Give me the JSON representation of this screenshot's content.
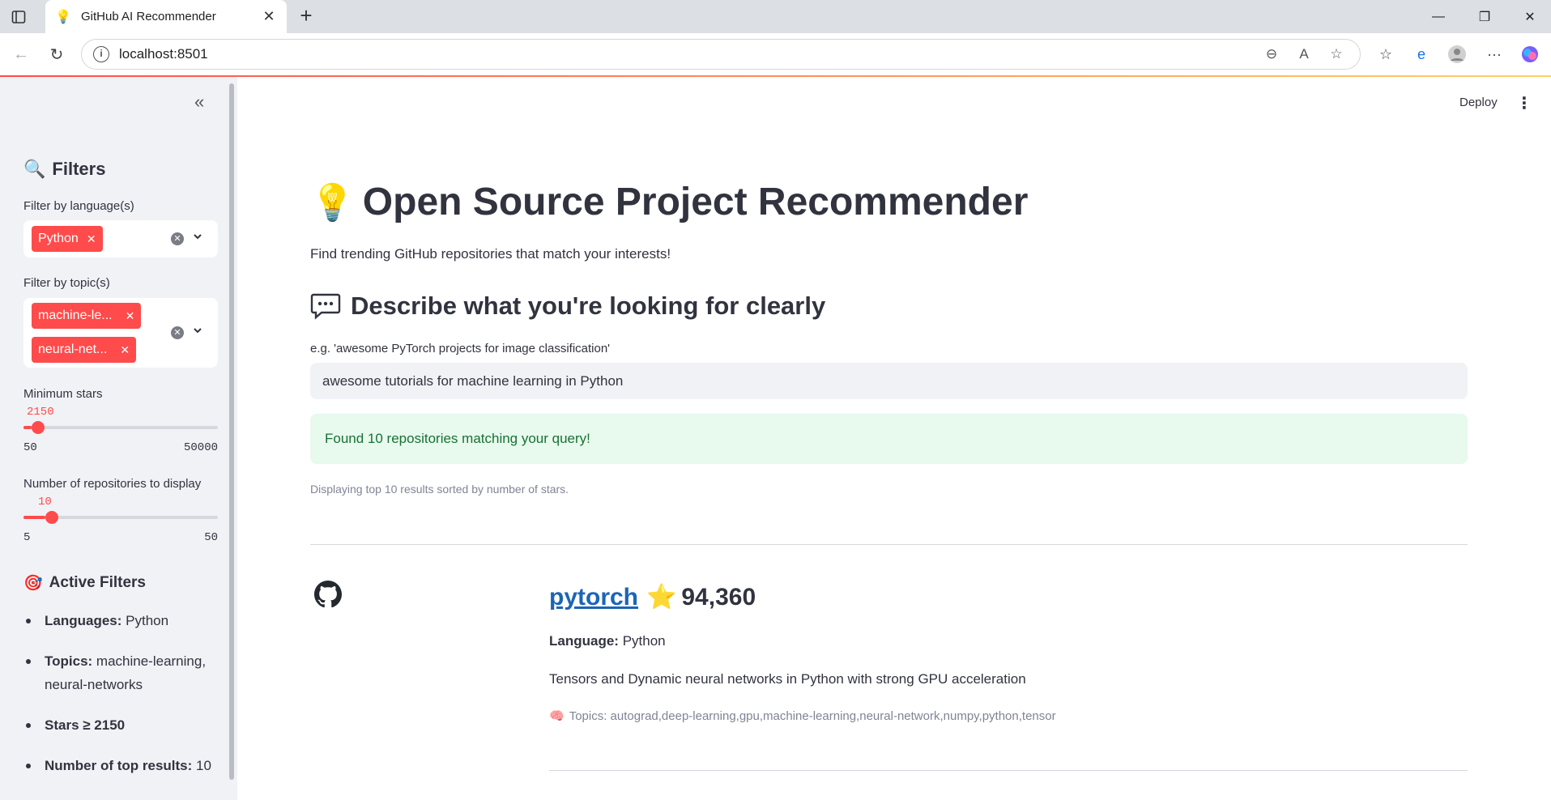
{
  "browser": {
    "tab_title": "GitHub AI Recommender",
    "url": "localhost:8501"
  },
  "sidebar": {
    "filters_heading": "Filters",
    "language_label": "Filter by language(s)",
    "language_chips": [
      "Python"
    ],
    "topic_label": "Filter by topic(s)",
    "topic_chips": [
      "machine-le...",
      "neural-net..."
    ],
    "min_stars_label": "Minimum stars",
    "min_stars_value": "2150",
    "min_stars_fraction": 0.042,
    "min_stars_min": "50",
    "min_stars_max": "50000",
    "num_repos_label": "Number of repositories to display",
    "num_repos_value": "10",
    "num_repos_fraction": 0.111,
    "num_repos_min": "5",
    "num_repos_max": "50",
    "active_heading": "Active Filters",
    "active": {
      "languages_key": "Languages:",
      "languages_val": "Python",
      "topics_key": "Topics:",
      "topics_val": "machine-learning, neural-networks",
      "stars_text": "Stars ≥ 2150",
      "top_key": "Number of top results:",
      "top_val": "10"
    }
  },
  "header": {
    "deploy_label": "Deploy"
  },
  "main": {
    "title": "Open Source Project Recommender",
    "subtitle": "Find trending GitHub repositories that match your interests!",
    "section_heading": "Describe what you're looking for clearly",
    "input_label": "e.g. 'awesome PyTorch projects for image classification'",
    "input_value": "awesome tutorials for machine learning in Python",
    "success_msg": "Found 10 repositories matching your query!",
    "caption": "Displaying top 10 results sorted by number of stars."
  },
  "repo": {
    "name": "pytorch",
    "stars": "94,360",
    "language_key": "Language:",
    "language_val": "Python",
    "description": "Tensors and Dynamic neural networks in Python with strong GPU acceleration",
    "topics": "Topics: autograd,deep-learning,gpu,machine-learning,neural-network,numpy,python,tensor"
  },
  "colors": {
    "accent": "#ff4b4b",
    "success_bg": "#e8f9ee",
    "success_text": "#177233",
    "link": "#1c65b5"
  }
}
